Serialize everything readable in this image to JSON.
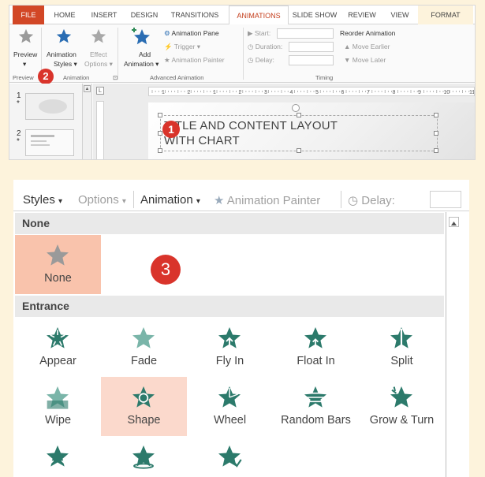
{
  "ribbon": {
    "tabs": [
      {
        "label": "FILE",
        "state": "file"
      },
      {
        "label": "HOME",
        "state": ""
      },
      {
        "label": "INSERT",
        "state": ""
      },
      {
        "label": "DESIGN",
        "state": ""
      },
      {
        "label": "TRANSITIONS",
        "state": ""
      },
      {
        "label": "ANIMATIONS",
        "state": "active"
      },
      {
        "label": "SLIDE SHOW",
        "state": ""
      },
      {
        "label": "REVIEW",
        "state": ""
      },
      {
        "label": "VIEW",
        "state": ""
      },
      {
        "label": "FORMAT",
        "state": "fmt"
      }
    ],
    "preview_label": "Preview",
    "animation_styles_label": "Animation",
    "animation_styles_label2": "Styles",
    "effect_options_label": "Effect",
    "effect_options_label2": "Options",
    "add_animation_label": "Add",
    "add_animation_label2": "Animation",
    "animation_pane_label": "Animation Pane",
    "trigger_label": "Trigger",
    "animation_painter_label": "Animation Painter",
    "start_label": "Start:",
    "duration_label": "Duration:",
    "delay_label": "Delay:",
    "reorder_label": "Reorder Animation",
    "move_earlier_label": "Move Earlier",
    "move_later_label": "Move Later",
    "groups": {
      "preview": "Preview",
      "animation": "Animation",
      "advanced": "Advanced Animation",
      "timing": "Timing"
    }
  },
  "slides": [
    {
      "number": "1",
      "marker": "*"
    },
    {
      "number": "2",
      "marker": "*"
    }
  ],
  "slide_title_line1": "TITLE AND CONTENT LAYOUT",
  "slide_title_line2": "WITH CHART",
  "callouts": {
    "one": "1",
    "two": "2",
    "three": "3"
  },
  "colors": {
    "accent": "#c43e1c",
    "badge": "#d9342b",
    "star": "#2c7a6b",
    "star_light": "#7ab5a9"
  },
  "gallery": {
    "toolbar": {
      "styles": "Styles",
      "options": "Options",
      "animation": "Animation",
      "painter": "Animation Painter",
      "delay": "Delay:"
    },
    "sections": [
      {
        "title": "None",
        "items": [
          {
            "label": "None",
            "icon": "none-star-icon",
            "state": "selected"
          }
        ]
      },
      {
        "title": "Entrance",
        "items": [
          {
            "label": "Appear",
            "icon": "appear-star-icon",
            "state": ""
          },
          {
            "label": "Fade",
            "icon": "fade-star-icon",
            "state": ""
          },
          {
            "label": "Fly In",
            "icon": "fly-in-star-icon",
            "state": ""
          },
          {
            "label": "Float In",
            "icon": "float-in-star-icon",
            "state": ""
          },
          {
            "label": "Split",
            "icon": "split-star-icon",
            "state": ""
          },
          {
            "label": "Wipe",
            "icon": "wipe-star-icon",
            "state": ""
          },
          {
            "label": "Shape",
            "icon": "shape-star-icon",
            "state": "hover"
          },
          {
            "label": "Wheel",
            "icon": "wheel-star-icon",
            "state": ""
          },
          {
            "label": "Random Bars",
            "icon": "random-bars-star-icon",
            "state": ""
          },
          {
            "label": "Grow & Turn",
            "icon": "grow-turn-star-icon",
            "state": ""
          },
          {
            "label": "",
            "icon": "zoom-star-icon",
            "state": ""
          },
          {
            "label": "",
            "icon": "swivel-star-icon",
            "state": ""
          },
          {
            "label": "",
            "icon": "bounce-star-icon",
            "state": ""
          }
        ]
      }
    ]
  }
}
